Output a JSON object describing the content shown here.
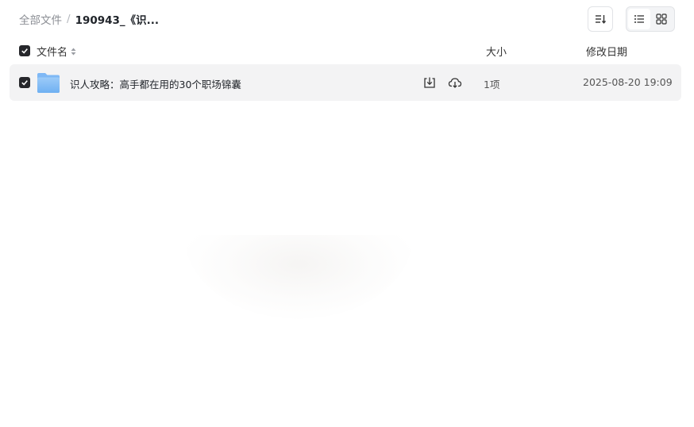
{
  "breadcrumb": {
    "root": "全部文件",
    "separator": "/",
    "current": "190943_《识..."
  },
  "toolbar": {
    "sort_icon": "sort-icon",
    "list_view_icon": "list-view-icon",
    "grid_view_icon": "grid-view-icon",
    "active_view": "list"
  },
  "table": {
    "columns": {
      "name": "文件名",
      "size": "大小",
      "modified": "修改日期"
    },
    "select_all_checked": true,
    "rows": [
      {
        "name": "识人攻略：高手都在用的30个职场锦囊",
        "type": "folder",
        "size": "1项",
        "modified": "2025-08-20 19:09",
        "checked": true
      }
    ]
  },
  "colors": {
    "checkbox": "#26272b",
    "row_highlight": "#f3f3f4",
    "folder": "#7fb8f5"
  }
}
